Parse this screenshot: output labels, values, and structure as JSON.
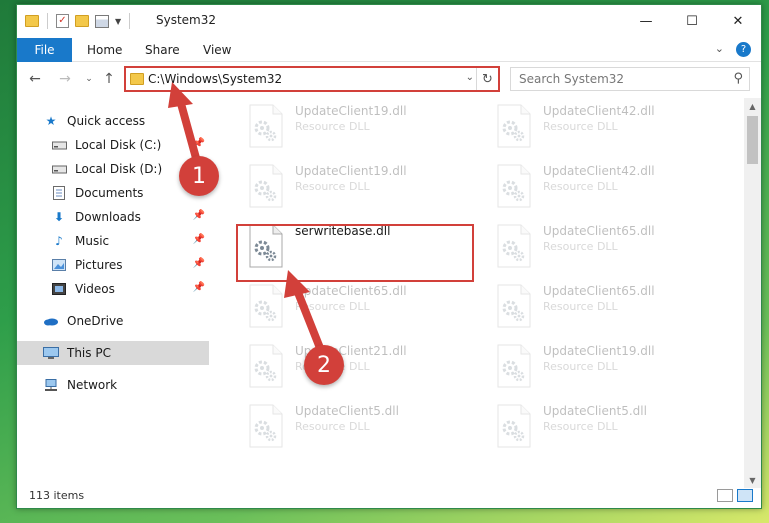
{
  "window": {
    "title": "System32",
    "controls": {
      "minimize": "—",
      "maximize": "☐",
      "close": "✕"
    }
  },
  "ribbon": {
    "tabs": [
      {
        "label": "File"
      },
      {
        "label": "Home"
      },
      {
        "label": "Share"
      },
      {
        "label": "View"
      }
    ]
  },
  "navigation": {
    "address": "C:\\Windows\\System32",
    "search_placeholder": "Search System32"
  },
  "sidebar": {
    "items": [
      {
        "label": "Quick access",
        "icon": "star-icon"
      },
      {
        "label": "Local Disk (C:)",
        "icon": "drive-icon",
        "pinned": true
      },
      {
        "label": "Local Disk (D:)",
        "icon": "drive-icon"
      },
      {
        "label": "Documents",
        "icon": "documents-icon"
      },
      {
        "label": "Downloads",
        "icon": "download-icon",
        "pinned": true
      },
      {
        "label": "Music",
        "icon": "music-icon",
        "pinned": true
      },
      {
        "label": "Pictures",
        "icon": "pictures-icon",
        "pinned": true
      },
      {
        "label": "Videos",
        "icon": "videos-icon",
        "pinned": true
      },
      {
        "label": "OneDrive",
        "icon": "cloud-icon"
      },
      {
        "label": "This PC",
        "icon": "pc-icon",
        "selected": true
      },
      {
        "label": "Network",
        "icon": "network-icon"
      }
    ]
  },
  "files": {
    "left": [
      {
        "name": "UpdateClient19.dll",
        "type": "Resource DLL"
      },
      {
        "name": "UpdateClient19.dll",
        "type": "Resource DLL"
      },
      {
        "name": "serwritebase.dll",
        "type": ""
      },
      {
        "name": "UpdateClient65.dll",
        "type": "Resource DLL"
      },
      {
        "name": "UpdateClient21.dll",
        "type": "Resource DLL"
      },
      {
        "name": "UpdateClient5.dll",
        "type": "Resource DLL"
      }
    ],
    "right": [
      {
        "name": "UpdateClient42.dll",
        "type": "Resource DLL"
      },
      {
        "name": "UpdateClient42.dll",
        "type": "Resource DLL"
      },
      {
        "name": "UpdateClient65.dll",
        "type": "Resource DLL"
      },
      {
        "name": "UpdateClient65.dll",
        "type": "Resource DLL"
      },
      {
        "name": "UpdateClient19.dll",
        "type": "Resource DLL"
      },
      {
        "name": "UpdateClient5.dll",
        "type": "Resource DLL"
      }
    ]
  },
  "status": {
    "item_count": "113 items"
  },
  "annotations": {
    "step1": "1",
    "step2": "2",
    "color": "#d2403a"
  }
}
